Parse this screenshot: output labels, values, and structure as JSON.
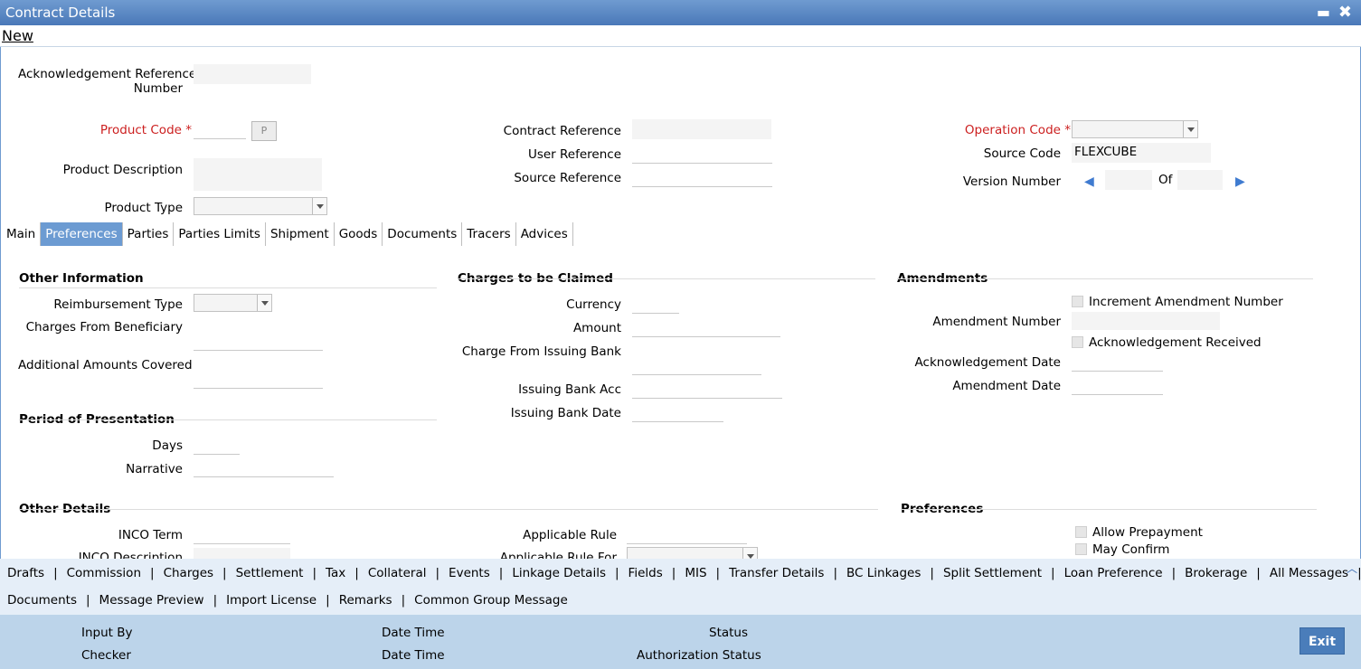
{
  "window": {
    "title": "Contract Details",
    "minimize": "▬",
    "close": "✖"
  },
  "menu": {
    "new": "New"
  },
  "header": {
    "ack_ref_label_1": "Acknowledgement Reference",
    "ack_ref_label_2": "Number",
    "product_code_label": "Product Code",
    "required_mark": "*",
    "product_code_button": "P",
    "product_description_label": "Product Description",
    "product_type_label": "Product Type",
    "contract_reference_label": "Contract Reference",
    "user_reference_label": "User Reference",
    "source_reference_label": "Source Reference",
    "operation_code_label": "Operation Code",
    "source_code_label": "Source Code",
    "source_code_value": "FLEXCUBE",
    "version_number_label": "Version Number",
    "version_of": "Of"
  },
  "tabs": [
    {
      "label": "Main",
      "active": false
    },
    {
      "label": "Preferences",
      "active": true
    },
    {
      "label": "Parties",
      "active": false
    },
    {
      "label": "Parties Limits",
      "active": false
    },
    {
      "label": "Shipment",
      "active": false
    },
    {
      "label": "Goods",
      "active": false
    },
    {
      "label": "Documents",
      "active": false
    },
    {
      "label": "Tracers",
      "active": false
    },
    {
      "label": "Advices",
      "active": false
    }
  ],
  "other_information": {
    "title": "Other Information",
    "reimbursement_type": "Reimbursement Type",
    "charges_from_beneficiary": "Charges From Beneficiary",
    "additional_amounts_covered": "Additional Amounts Covered"
  },
  "period_of_presentation": {
    "title": "Period of Presentation",
    "days": "Days",
    "narrative": "Narrative"
  },
  "other_details": {
    "title": "Other Details",
    "inco_term": "INCO Term",
    "inco_description": "INCO Description",
    "applicable_rule": "Applicable Rule",
    "applicable_rule_for": "Applicable Rule For"
  },
  "charges_to_be_claimed": {
    "title": "Charges to be Claimed",
    "currency": "Currency",
    "amount": "Amount",
    "charge_from_issuing_bank": "Charge From Issuing Bank",
    "issuing_bank_acc": "Issuing Bank Acc",
    "issuing_bank_date": "Issuing Bank Date"
  },
  "amendments": {
    "title": "Amendments",
    "increment_amendment_number": "Increment Amendment Number",
    "amendment_number": "Amendment Number",
    "acknowledgement_received": "Acknowledgement Received",
    "acknowledgement_date": "Acknowledgement Date",
    "amendment_date": "Amendment Date"
  },
  "preferences": {
    "title": "Preferences",
    "allow_prepayment": "Allow Prepayment",
    "may_confirm": "May Confirm"
  },
  "footer_links_row1": [
    "Drafts",
    "Commission",
    "Charges",
    "Settlement",
    "Tax",
    "Collateral",
    "Events",
    "Linkage Details",
    "Fields",
    "MIS",
    "Transfer Details",
    "BC Linkages",
    "Split Settlement",
    "Loan Preference",
    "Brokerage",
    "All Messages"
  ],
  "footer_links_row2": [
    "Documents",
    "Message Preview",
    "Import License",
    "Remarks",
    "Common Group Message"
  ],
  "footer_separator": "|",
  "audit": {
    "input_by": "Input By",
    "checker": "Checker",
    "date_time_1": "Date Time",
    "date_time_2": "Date Time",
    "status": "Status",
    "authorization_status": "Authorization Status",
    "exit": "Exit"
  },
  "icons": {
    "prev": "◀",
    "next": "▶",
    "scroll_up": "︿"
  },
  "colors": {
    "title_bar": "#4a78b8",
    "active_tab": "#6c9bd2",
    "required": "#cc1f1f",
    "footer_top": "#e5eef8",
    "footer_bottom": "#bcd4ea"
  }
}
